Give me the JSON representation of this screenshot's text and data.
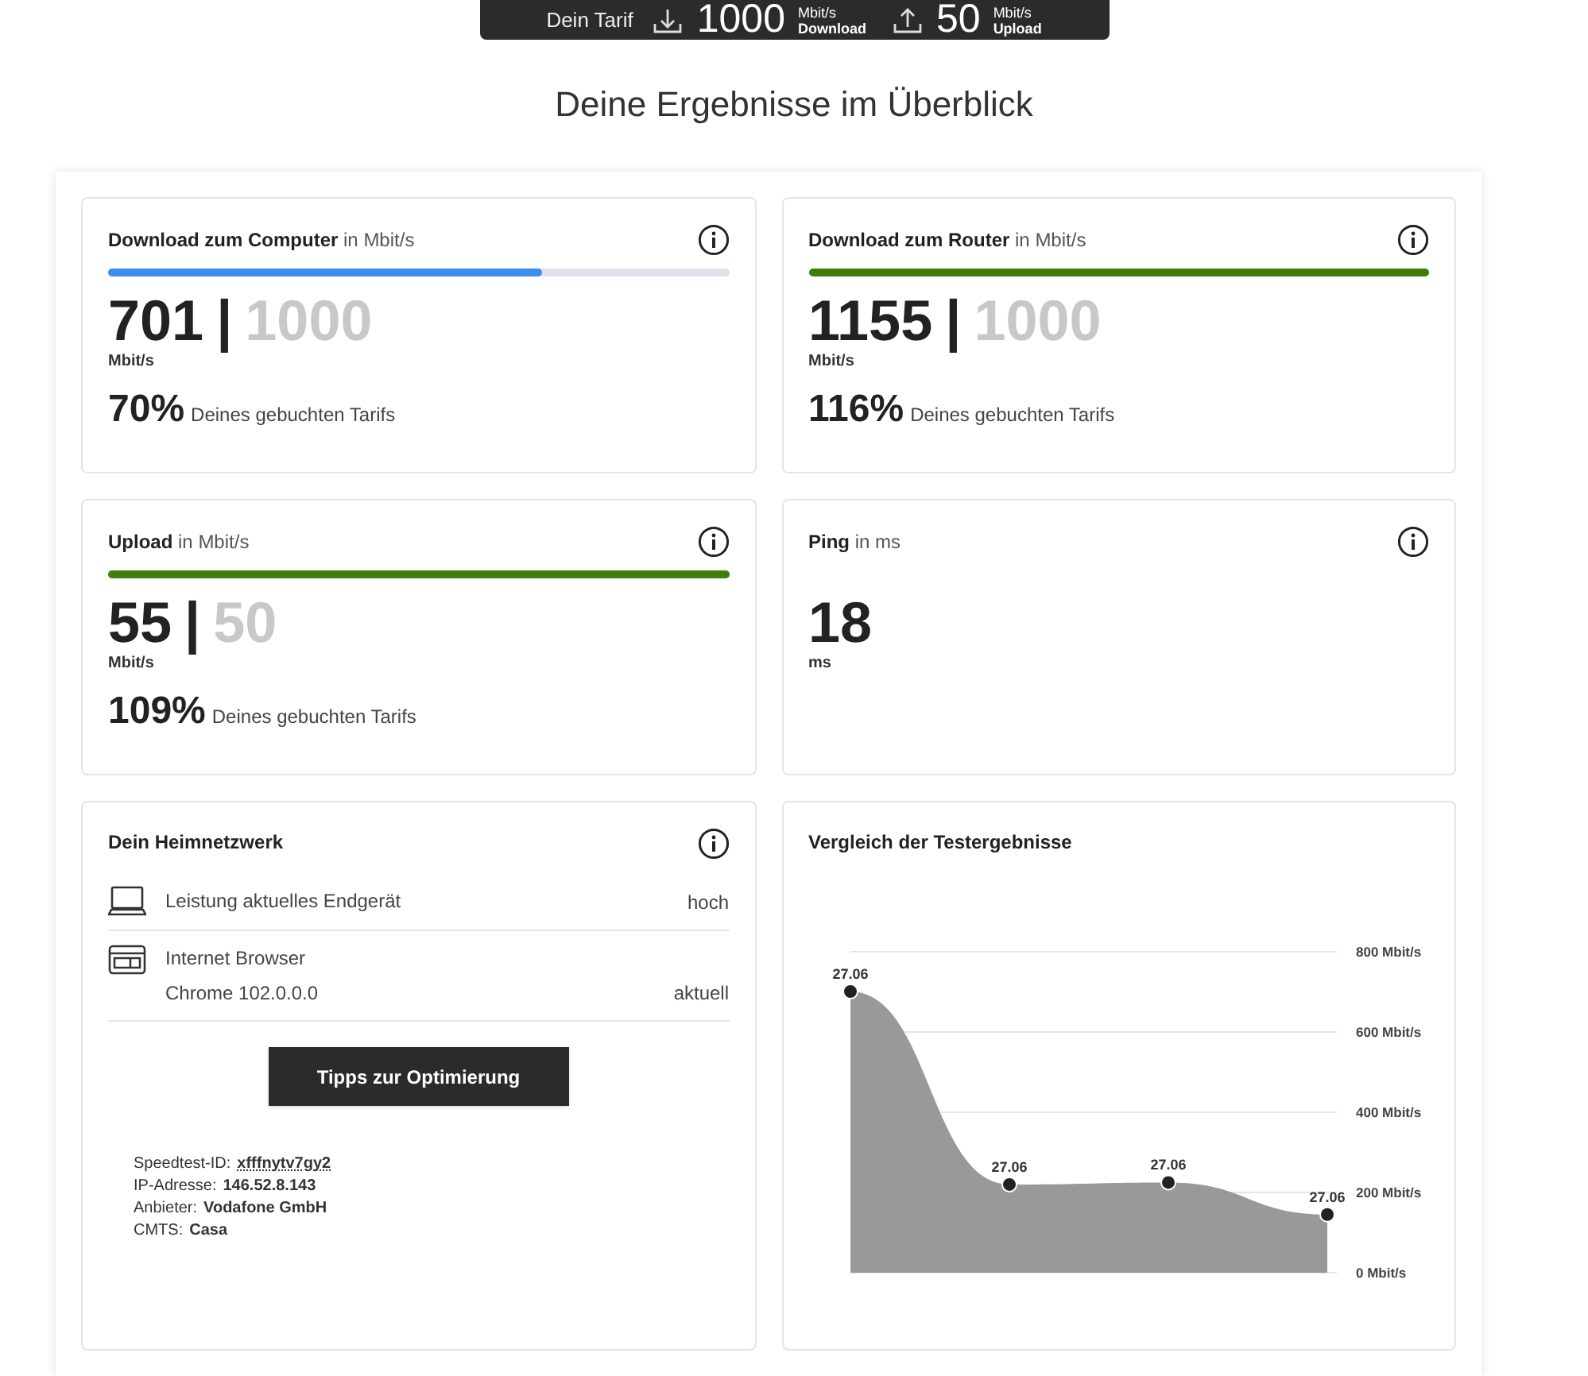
{
  "tariff_bar": {
    "label": "Dein Tarif",
    "download": {
      "value": "1000",
      "unit": "Mbit/s",
      "label": "Download"
    },
    "upload": {
      "value": "50",
      "unit": "Mbit/s",
      "label": "Upload"
    }
  },
  "heading": "Deine Ergebnisse im Überblick",
  "metrics": [
    {
      "title": "Download zum Computer",
      "unit_note": "in Mbit/s",
      "level": 0.7,
      "color": "#3b8eed",
      "value": "701",
      "separator": "|",
      "target": "1000",
      "value_unit": "Mbit/s",
      "percent": "70%",
      "percent_text": "Deines gebuchten Tarifs"
    },
    {
      "title": "Download zum Router",
      "unit_note": "in Mbit/s",
      "level": 1,
      "color": "#3f7e0b",
      "value": "1155",
      "separator": "|",
      "target": "1000",
      "value_unit": "Mbit/s",
      "percent": "116%",
      "percent_text": "Deines gebuchten Tarifs"
    },
    {
      "title": "Upload",
      "unit_note": "in Mbit/s",
      "level": 1,
      "color": "#3f7e0b",
      "value": "55",
      "separator": "|",
      "target": "50",
      "value_unit": "Mbit/s",
      "percent": "109%",
      "percent_text": "Deines gebuchten Tarifs"
    },
    {
      "title": "Ping",
      "unit_note": "in ms",
      "value": "18",
      "value_unit": "ms"
    }
  ],
  "home_network": {
    "title": "Dein Heimnetzwerk",
    "rows": [
      {
        "kind": "laptop",
        "label": "Leistung aktuelles Endgerät",
        "status": "hoch"
      },
      {
        "kind": "browser",
        "label": "Internet Browser",
        "detail": "Chrome 102.0.0.0",
        "status": "aktuell"
      }
    ],
    "button": "Tipps zur Optimierung",
    "info": [
      {
        "label": "Speedtest-ID:",
        "value": "xfffnytv7gy2",
        "kind": "link"
      },
      {
        "label": "IP-Adresse:",
        "value": "146.52.8.143",
        "kind": "text"
      },
      {
        "label": "Anbieter:",
        "value": "Vodafone GmbH",
        "kind": "text"
      },
      {
        "label": "CMTS:",
        "value": "Casa",
        "kind": "text"
      }
    ]
  },
  "comparison": {
    "title": "Vergleich der Testergebnisse",
    "chart_data": {
      "type": "area",
      "grid": true,
      "series": [
        {
          "color": "#999999",
          "values": [
            701,
            220,
            225,
            145
          ]
        }
      ],
      "ylim": [
        0,
        800
      ],
      "yticks": [
        {
          "value": 0,
          "label": "0 Mbit/s"
        },
        {
          "value": 200,
          "label": "200 Mbit/s"
        },
        {
          "value": 400,
          "label": "400 Mbit/s"
        },
        {
          "value": 600,
          "label": "600 Mbit/s"
        },
        {
          "value": 800,
          "label": "800 Mbit/s"
        }
      ],
      "value_labels": [
        "27.06",
        "27.06",
        "27.06",
        "27.06"
      ]
    }
  }
}
